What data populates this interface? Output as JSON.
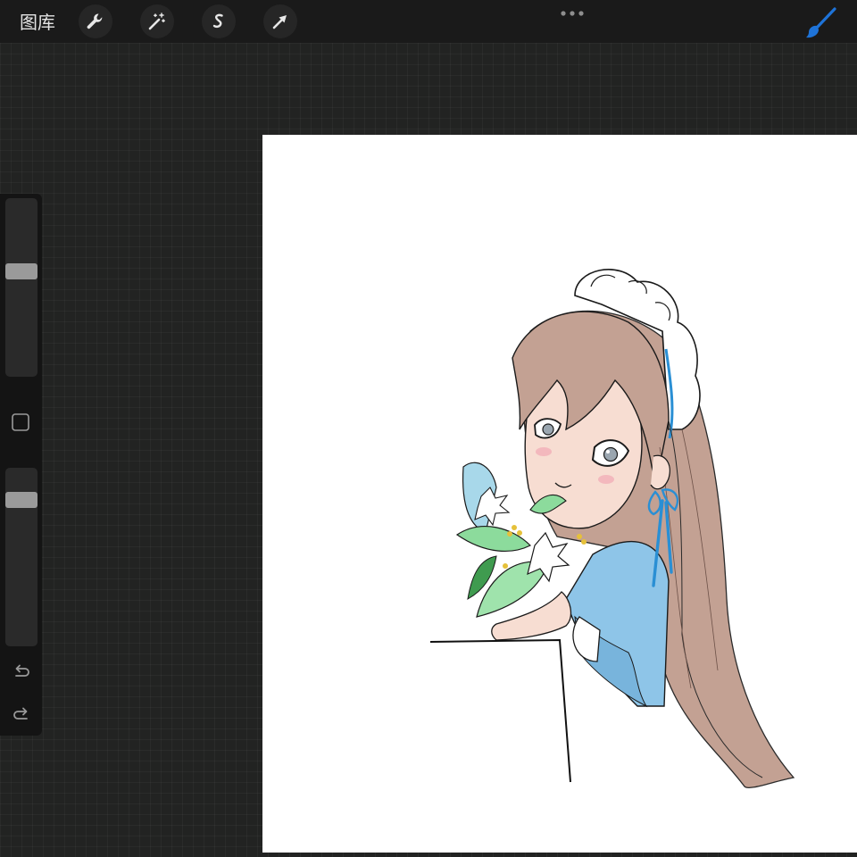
{
  "toolbar": {
    "gallery_label": "图库",
    "icons": [
      "wrench-icon",
      "magic-wand-icon",
      "selection-icon",
      "transform-arrow-icon"
    ],
    "more_icon": "more-dots-icon",
    "brush_icon": "brush-icon",
    "accent_color": "#1e73d8"
  },
  "sidebar": {
    "brush_size_level": 0.6,
    "opacity_level": 0.85,
    "modifier_icon": "square-modifier-icon",
    "undo_icon": "undo-icon",
    "redo_icon": "redo-icon"
  },
  "canvas": {
    "artwork": "anime-maid-girl-with-bouquet"
  }
}
